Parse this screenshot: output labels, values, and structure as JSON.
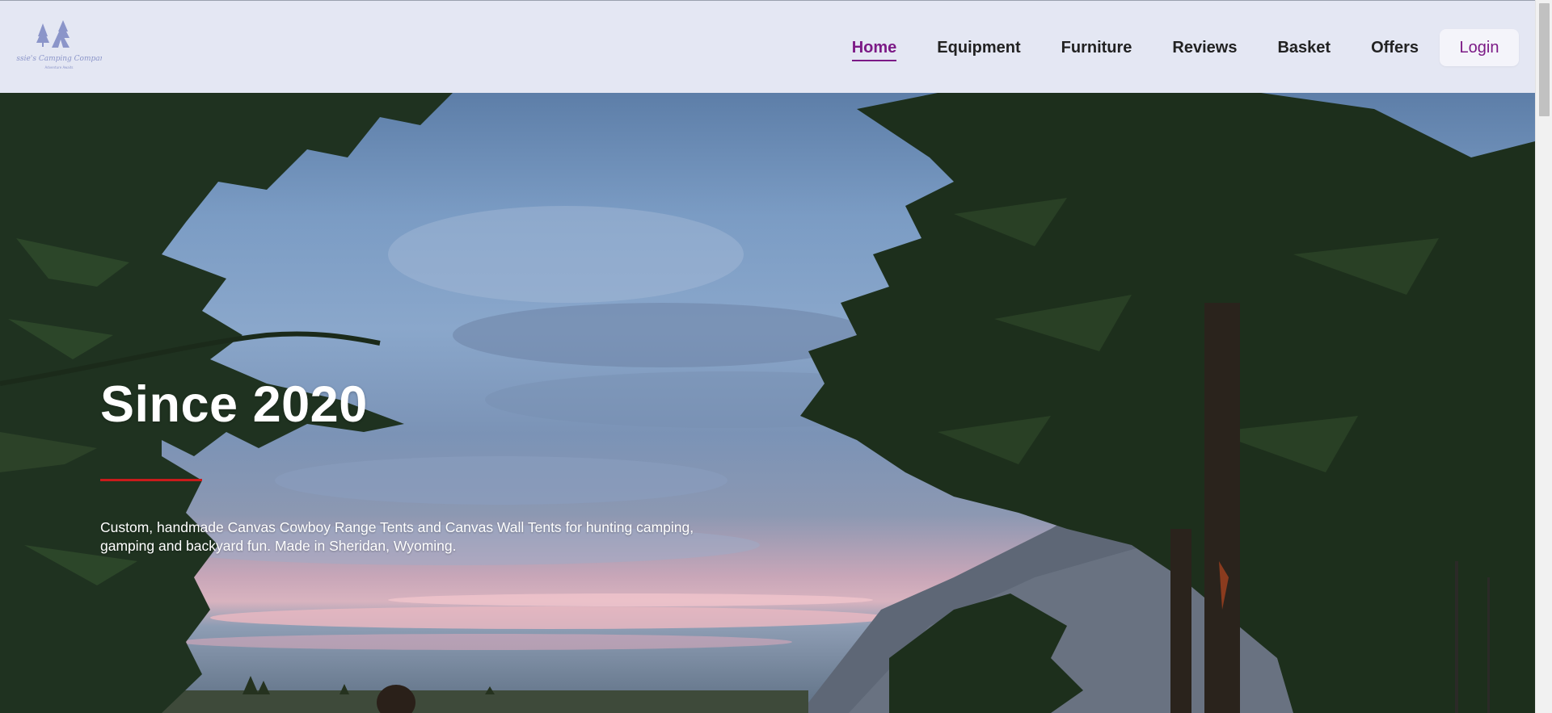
{
  "brand": {
    "logo_text": "Jessie's Camping Company",
    "logo_tagline": "Adventure Awaits"
  },
  "nav": {
    "items": [
      {
        "label": "Home",
        "active": true
      },
      {
        "label": "Equipment",
        "active": false
      },
      {
        "label": "Furniture",
        "active": false
      },
      {
        "label": "Reviews",
        "active": false
      },
      {
        "label": "Basket",
        "active": false
      },
      {
        "label": "Offers",
        "active": false
      }
    ],
    "login_label": "Login"
  },
  "hero": {
    "title": "Since 2020",
    "description": "Custom, handmade Canvas Cowboy Range Tents and Canvas Wall Tents for hunting camping, gamping and backyard fun. Made in Sheridan, Wyoming."
  },
  "colors": {
    "header_bg": "#e4e7f3",
    "accent": "#7c1a86",
    "rule": "#c91b1b"
  }
}
